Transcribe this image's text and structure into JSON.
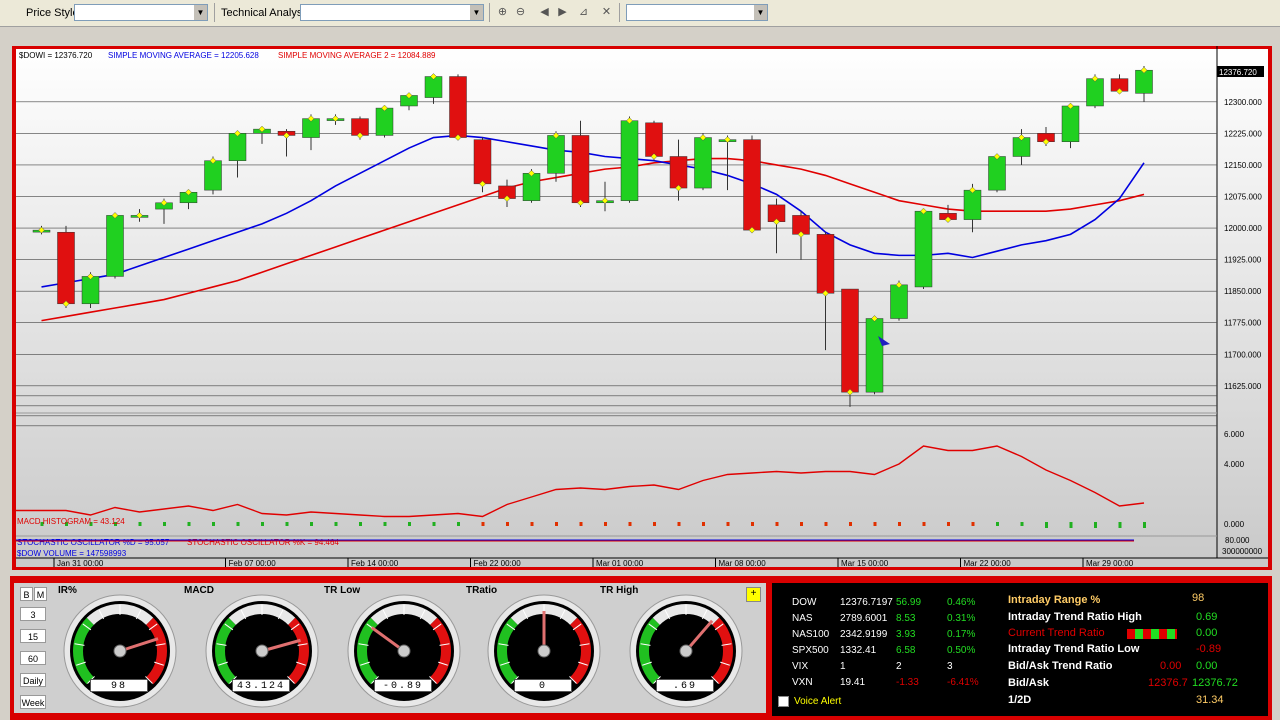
{
  "toolbar": {
    "price_style_label": "Price Style",
    "indicator_label": "Technical Analysis"
  },
  "chart_header": {
    "symbol_text": "$DOWI = 12376.720",
    "sma1_text": "SIMPLE MOVING AVERAGE = 12205.628",
    "sma2_text": "SIMPLE MOVING AVERAGE 2 = 12084.889",
    "last_price_tag": "12376.720"
  },
  "panel_labels": {
    "macd": "MACD HISTOGRAM = 43.124",
    "stoch": "STOCHASTIC OSCILLATOR %D = 95.057",
    "stochk": "STOCHASTIC OSCILLATOR %K = 94.464",
    "volume": "$DOW VOLUME = 147598993"
  },
  "colors": {
    "up": "#20d020",
    "down": "#e01010",
    "sma1": "#0000e0",
    "sma2": "#e00000",
    "accent_red": "#d80000"
  },
  "chart_data": {
    "type": "candlestick",
    "x_labels": [
      "Jan 31 00:00",
      "Feb 07 00:00",
      "Feb 14 00:00",
      "Feb 22 00:00",
      "Mar 01 00:00",
      "Mar 08 00:00",
      "Mar 15 00:00",
      "Mar 22 00:00",
      "Mar 29 00:00"
    ],
    "x_label_index": [
      1,
      8,
      13,
      18,
      23,
      28,
      33,
      38,
      43
    ],
    "y_ticks": [
      12300,
      12225,
      12150,
      12075,
      12000,
      11925,
      11850,
      11775,
      11700,
      11625
    ],
    "y_tick_labels": [
      "12300.000",
      "12225.000",
      "12150.000",
      "12075.000",
      "12000.000",
      "11925.000",
      "11850.000",
      "11775.000",
      "11700.000",
      "11625.000"
    ],
    "y_range": [
      11570,
      12385
    ],
    "ohlc": [
      [
        11995,
        12005,
        11985,
        11995
      ],
      [
        11990,
        12005,
        11810,
        11820
      ],
      [
        11820,
        11895,
        11810,
        11885
      ],
      [
        11885,
        12035,
        11880,
        12030
      ],
      [
        12030,
        12045,
        12015,
        12030
      ],
      [
        12045,
        12070,
        12010,
        12060
      ],
      [
        12060,
        12090,
        12045,
        12085
      ],
      [
        12090,
        12170,
        12080,
        12160
      ],
      [
        12160,
        12230,
        12120,
        12225
      ],
      [
        12225,
        12240,
        12200,
        12235
      ],
      [
        12230,
        12235,
        12170,
        12220
      ],
      [
        12215,
        12270,
        12185,
        12260
      ],
      [
        12260,
        12270,
        12245,
        12260
      ],
      [
        12260,
        12265,
        12210,
        12220
      ],
      [
        12220,
        12290,
        12215,
        12285
      ],
      [
        12290,
        12320,
        12280,
        12315
      ],
      [
        12310,
        12365,
        12295,
        12360
      ],
      [
        12360,
        12365,
        12210,
        12215
      ],
      [
        12210,
        12215,
        12085,
        12105
      ],
      [
        12100,
        12115,
        12050,
        12070
      ],
      [
        12065,
        12140,
        12060,
        12130
      ],
      [
        12130,
        12230,
        12110,
        12220
      ],
      [
        12220,
        12255,
        12050,
        12060
      ],
      [
        12060,
        12110,
        12040,
        12065
      ],
      [
        12065,
        12265,
        12060,
        12255
      ],
      [
        12250,
        12255,
        12160,
        12170
      ],
      [
        12170,
        12210,
        12065,
        12095
      ],
      [
        12095,
        12225,
        12090,
        12215
      ],
      [
        12210,
        12220,
        12090,
        12210
      ],
      [
        12210,
        12220,
        11990,
        11995
      ],
      [
        12055,
        12070,
        11940,
        12015
      ],
      [
        12030,
        12040,
        11925,
        11985
      ],
      [
        11985,
        11990,
        11710,
        11845
      ],
      [
        11855,
        11855,
        11575,
        11610
      ],
      [
        11610,
        11790,
        11605,
        11785
      ],
      [
        11785,
        11875,
        11780,
        11865
      ],
      [
        11860,
        12045,
        11855,
        12040
      ],
      [
        12035,
        12055,
        12025,
        12020
      ],
      [
        12020,
        12105,
        11990,
        12090
      ],
      [
        12090,
        12170,
        12085,
        12170
      ],
      [
        12170,
        12235,
        12150,
        12215
      ],
      [
        12225,
        12240,
        12195,
        12205
      ],
      [
        12205,
        12290,
        12190,
        12290
      ],
      [
        12290,
        12365,
        12285,
        12355
      ],
      [
        12355,
        12365,
        12325,
        12325
      ],
      [
        12320,
        12385,
        12300,
        12375
      ]
    ],
    "sma1": [
      11860,
      11870,
      11880,
      11890,
      11910,
      11930,
      11950,
      11970,
      11990,
      12010,
      12035,
      12065,
      12100,
      12130,
      12160,
      12190,
      12215,
      12220,
      12215,
      12205,
      12195,
      12185,
      12180,
      12170,
      12165,
      12160,
      12150,
      12140,
      12125,
      12105,
      12080,
      12040,
      11990,
      11960,
      11940,
      11935,
      11935,
      11940,
      11930,
      11945,
      11960,
      11970,
      11985,
      12020,
      12070,
      12155
    ],
    "sma2": [
      11780,
      11790,
      11800,
      11810,
      11820,
      11830,
      11845,
      11860,
      11875,
      11895,
      11915,
      11935,
      11955,
      11975,
      11995,
      12015,
      12035,
      12055,
      12075,
      12095,
      12110,
      12120,
      12130,
      12140,
      12145,
      12155,
      12160,
      12165,
      12165,
      12160,
      12150,
      12140,
      12125,
      12105,
      12085,
      12065,
      12055,
      12045,
      12040,
      12040,
      12040,
      12040,
      12045,
      12055,
      12065,
      12080
    ],
    "macd_line": [
      0.9,
      0.9,
      0.6,
      1.1,
      0.8,
      1.0,
      1.2,
      0.9,
      1.3,
      0.7,
      0.6,
      0.8,
      0.7,
      0.6,
      0.5,
      0.5,
      0.6,
      0.7,
      0.5,
      1.3,
      1.8,
      2.3,
      2.4,
      2.3,
      2.5,
      2.6,
      2.3,
      2.9,
      3.3,
      3.4,
      3.5,
      3.4,
      3.5,
      3.5,
      3.3,
      4.0,
      5.2,
      4.9,
      4.9,
      5.2,
      4.5,
      3.6,
      2.9,
      2.1,
      1.2,
      1.4
    ],
    "macd_y_ticks": [
      6.0,
      4.0,
      0.0
    ],
    "macd_y_tick_labels": [
      "6.000",
      "4.000",
      "0.000"
    ],
    "stoch_tick_label": "80.000",
    "volume_tick_label": "300000000"
  },
  "gauges": [
    {
      "title": "IR%",
      "value": "98"
    },
    {
      "title": "MACD",
      "value": "43.124"
    },
    {
      "title": "TR Low",
      "value": "-0.89"
    },
    {
      "title": "TRatio",
      "value": "0"
    },
    {
      "title": "TR High",
      "value": ".69"
    }
  ],
  "period_buttons": [
    "3",
    "15",
    "60",
    "Daily",
    "Week"
  ],
  "mode_buttons": [
    "B",
    "M"
  ],
  "market": [
    {
      "sym": "DOW",
      "last": "12376.7197",
      "chg": "56.99",
      "pct": "0.46%"
    },
    {
      "sym": "NAS",
      "last": "2789.6001",
      "chg": "8.53",
      "pct": "0.31%"
    },
    {
      "sym": "NAS100",
      "last": "2342.9199",
      "chg": "3.93",
      "pct": "0.17%"
    },
    {
      "sym": "SPX500",
      "last": "1332.41",
      "chg": "6.58",
      "pct": "0.50%"
    },
    {
      "sym": "VIX",
      "last": "1",
      "chg": "2",
      "pct": "3"
    },
    {
      "sym": "VXN",
      "last": "19.41",
      "chg": "-1.33",
      "pct": "-6.41%"
    }
  ],
  "voice_alert_label": "Voice Alert",
  "indicators": {
    "range_label": "Intraday Range %",
    "range_val": "98",
    "high_label": "Intraday Trend Ratio High",
    "high_val": "0.69",
    "current_label": "Current Trend Ratio",
    "current_val": "0.00",
    "low_label": "Intraday Trend Ratio Low",
    "low_val": "-0.89",
    "bidask_tr_label": "Bid/Ask Trend Ratio",
    "bidask_tr_val1": "0.00",
    "bidask_tr_val2": "0.00",
    "bidask_label": "Bid/Ask",
    "bid_val": "12376.7",
    "ask_val": "12376.72",
    "half_label": "1/2D",
    "half_val": "31.34"
  }
}
